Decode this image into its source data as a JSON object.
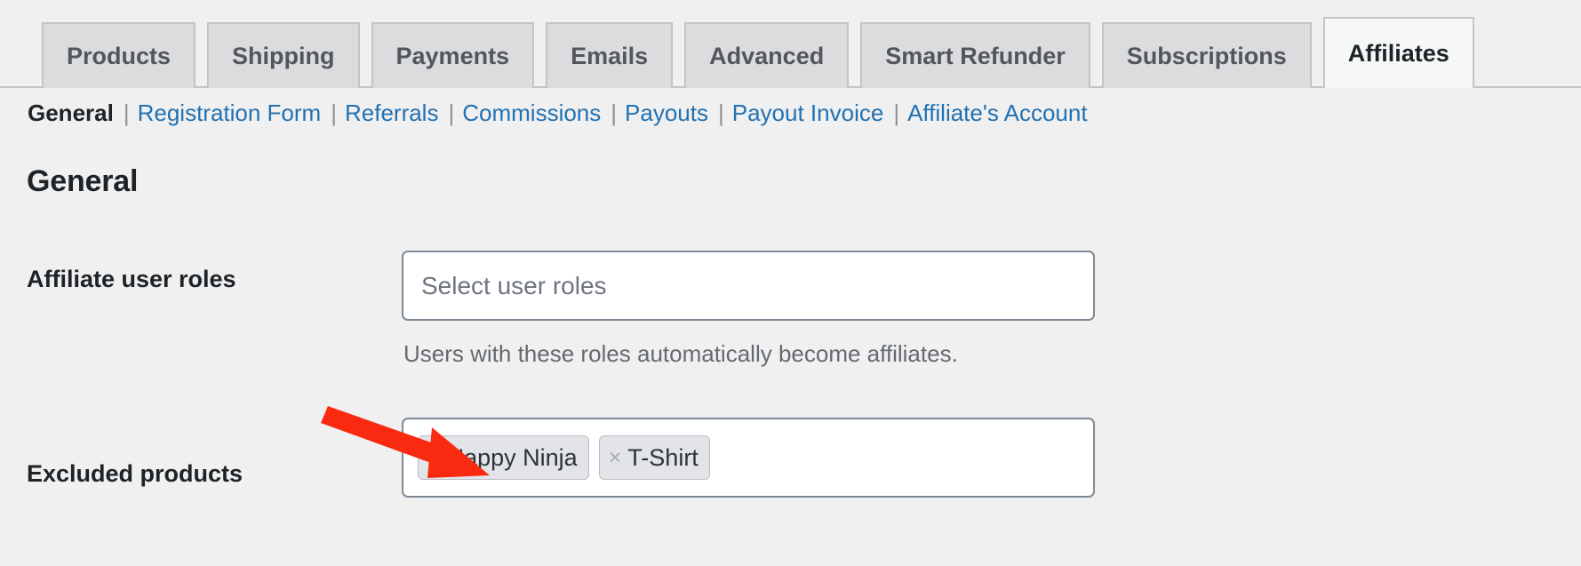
{
  "tabs": [
    {
      "label": "Products",
      "active": false
    },
    {
      "label": "Shipping",
      "active": false
    },
    {
      "label": "Payments",
      "active": false
    },
    {
      "label": "Emails",
      "active": false
    },
    {
      "label": "Advanced",
      "active": false
    },
    {
      "label": "Smart Refunder",
      "active": false
    },
    {
      "label": "Subscriptions",
      "active": false
    },
    {
      "label": "Affiliates",
      "active": true
    }
  ],
  "subnav": {
    "separator": "|",
    "items": [
      {
        "label": "General",
        "current": true
      },
      {
        "label": "Registration Form",
        "current": false
      },
      {
        "label": "Referrals",
        "current": false
      },
      {
        "label": "Commissions",
        "current": false
      },
      {
        "label": "Payouts",
        "current": false
      },
      {
        "label": "Payout Invoice",
        "current": false
      },
      {
        "label": "Affiliate's Account",
        "current": false
      }
    ]
  },
  "page": {
    "heading": "General"
  },
  "fields": {
    "affiliate_user_roles": {
      "label": "Affiliate user roles",
      "placeholder": "Select user roles",
      "value": "",
      "help": "Users with these roles automatically become affiliates."
    },
    "excluded_products": {
      "label": "Excluded products",
      "remove_glyph": "×",
      "tags": [
        {
          "label": "Happy Ninja"
        },
        {
          "label": "T-Shirt"
        }
      ]
    }
  },
  "annotation": {
    "arrow_color": "#FA2A10",
    "name": "red-arrow-pointing-to-excluded-products"
  },
  "colors": {
    "page_background": "#F0F0F1",
    "tab_inactive_bg": "#DCDCDE",
    "tab_active_bg": "#F6F7F7",
    "tab_border": "#C3C4C7",
    "link": "#2271B1",
    "text_dark": "#1D2327",
    "text_muted": "#646970",
    "input_border": "#7E8A95",
    "tag_bg": "#E2E4E7"
  }
}
